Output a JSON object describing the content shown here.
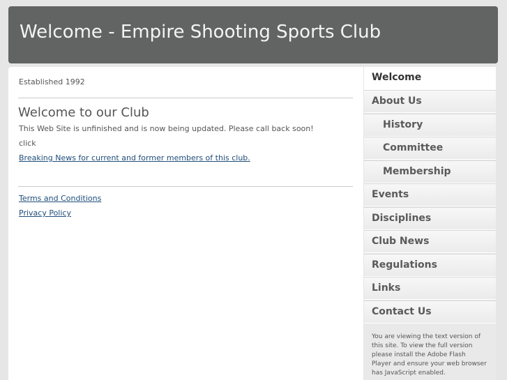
{
  "header": {
    "title": "Welcome - Empire Shooting Sports Club"
  },
  "main": {
    "established": "Established 1992",
    "heading": "Welcome to our Club",
    "notice": "This Web Site is unfinished and is now being updated. Please call back soon!",
    "click_text": "click",
    "news_link": "Breaking News for current and former members of this club.",
    "terms_link": "Terms and Conditions",
    "privacy_link": "Privacy Policy"
  },
  "nav": {
    "items": [
      {
        "label": "Welcome",
        "active": true
      },
      {
        "label": "About Us"
      },
      {
        "label": "History"
      },
      {
        "label": "Committee"
      },
      {
        "label": "Membership"
      },
      {
        "label": "Events"
      },
      {
        "label": "Disciplines"
      },
      {
        "label": "Club News"
      },
      {
        "label": "Regulations"
      },
      {
        "label": "Links"
      },
      {
        "label": "Contact Us"
      }
    ],
    "note": "You are viewing the text version of this site. To view the full version please install the Adobe Flash Player and ensure your web browser has JavaScript enabled."
  }
}
